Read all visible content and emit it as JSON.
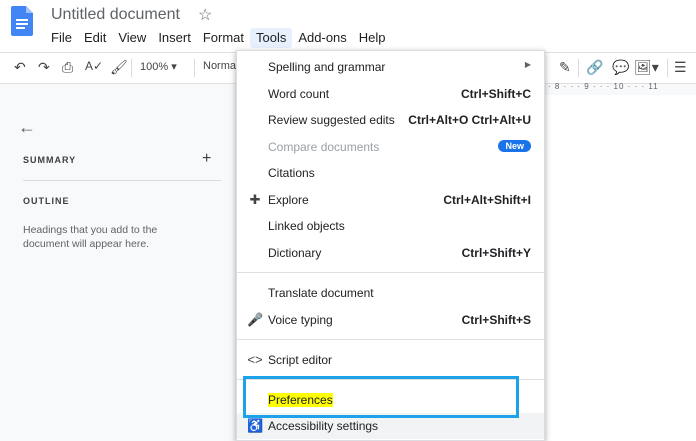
{
  "doc": {
    "title": "Untitled document"
  },
  "menubar": [
    "File",
    "Edit",
    "View",
    "Insert",
    "Format",
    "Tools",
    "Add-ons",
    "Help"
  ],
  "toolbar": {
    "zoom": "100%",
    "style": "Normal"
  },
  "ruler": {
    "ticks": "· 8 · · · 9 · · · 10 · · · 11"
  },
  "outline_pane": {
    "summary_label": "SUMMARY",
    "outline_label": "OUTLINE",
    "hint": "Headings that you add to the document will appear here."
  },
  "tools_menu": {
    "items": [
      {
        "label": "Spelling and grammar",
        "shortcut": "",
        "submenu": true
      },
      {
        "label": "Word count",
        "shortcut": "Ctrl+Shift+C"
      },
      {
        "label": "Review suggested edits",
        "shortcut": "Ctrl+Alt+O Ctrl+Alt+U"
      },
      {
        "label": "Compare documents",
        "badge": "New",
        "disabled": true
      },
      {
        "label": "Citations",
        "shortcut": ""
      },
      {
        "label": "Explore",
        "shortcut": "Ctrl+Alt+Shift+I"
      },
      {
        "label": "Linked objects",
        "shortcut": ""
      },
      {
        "label": "Dictionary",
        "shortcut": "Ctrl+Shift+Y"
      },
      {
        "label": "Translate document",
        "shortcut": ""
      },
      {
        "label": "Voice typing",
        "shortcut": "Ctrl+Shift+S"
      },
      {
        "label": "Script editor",
        "shortcut": ""
      },
      {
        "label": "Preferences",
        "shortcut": ""
      },
      {
        "label": "Accessibility settings",
        "shortcut": ""
      }
    ]
  },
  "colors": {
    "accent": "#1a73e8",
    "highlight_box": "#1ca2e8",
    "text_highlight": "#ffff00"
  }
}
